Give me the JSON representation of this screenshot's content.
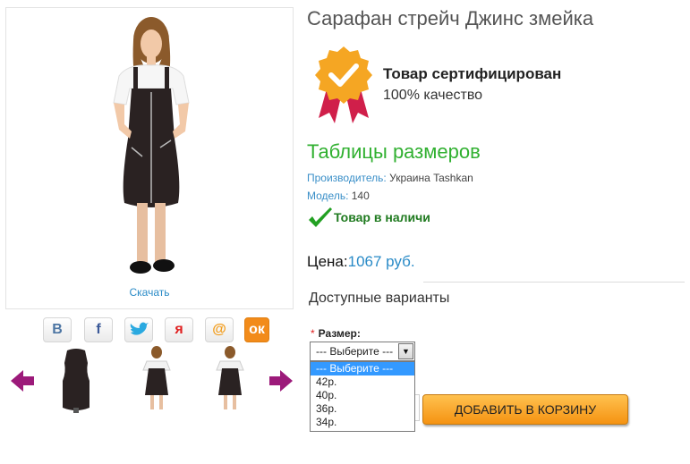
{
  "product": {
    "title": "Сарафан стрейч Джинс змейка",
    "download_label": "Скачать"
  },
  "share": [
    "vk-icon",
    "facebook-icon",
    "twitter-icon",
    "moimir-icon",
    "mail-icon",
    "odnoklassniki-icon"
  ],
  "certificate": {
    "title": "Товар сертифицирован",
    "subtitle": "100% качество"
  },
  "size_tables_link": "Таблицы размеров",
  "manufacturer": {
    "label": "Производитель:",
    "value": "Украина Tashkan"
  },
  "model": {
    "label": "Модель:",
    "value": "140"
  },
  "stock_status": "Товар в наличи",
  "price": {
    "label": "Цена:",
    "value": "1067 руб."
  },
  "variants": {
    "title": "Доступные варианты",
    "size_label": "Размер:",
    "required_mark": "*",
    "selected": "--- Выберите ---",
    "options": [
      "--- Выберите ---",
      "42р.",
      "40р.",
      "36р.",
      "34р."
    ]
  },
  "add_to_cart_label": "ДОБАВИТЬ В КОРЗИНУ",
  "colors": {
    "link": "#2a8bc7",
    "green_link": "#30b030",
    "stock_green": "#1f7a1f",
    "button_orange": "#f59312",
    "arrow_purple": "#9c1a7a"
  }
}
